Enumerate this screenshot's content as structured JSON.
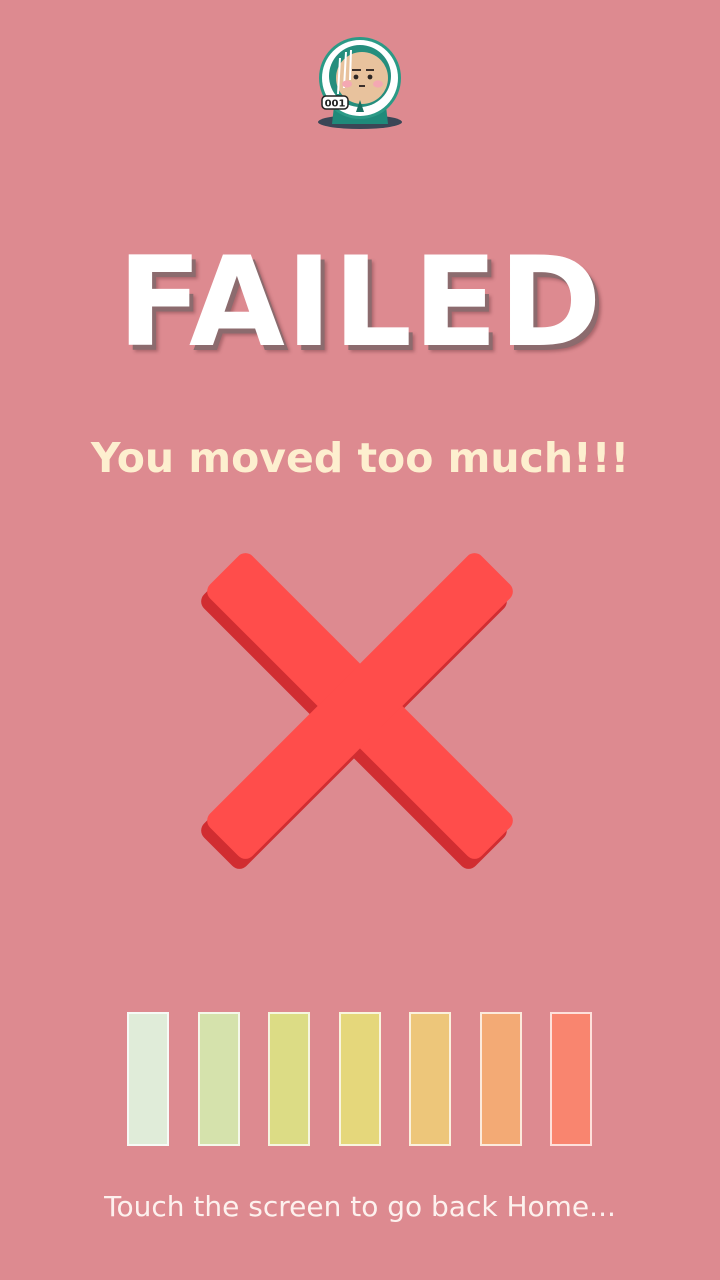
{
  "screen": {
    "title": "FAILED",
    "message": "You moved too much!!!",
    "footer_hint": "Touch the screen to go back Home..."
  },
  "avatar": {
    "icon": "player-avatar-icon",
    "badge_number": "001"
  },
  "result_icon": "x-mark-icon",
  "progress_bars": [
    {
      "color": "#e0ecd9"
    },
    {
      "color": "#d5e2ac"
    },
    {
      "color": "#dcdc85"
    },
    {
      "color": "#e5d77b"
    },
    {
      "color": "#edc67a"
    },
    {
      "color": "#f3aa75"
    },
    {
      "color": "#f9856f"
    }
  ],
  "colors": {
    "background": "#dd8a90",
    "title": "#ffffff",
    "message": "#fdefcf",
    "cross": "#ff4d4b",
    "cross_shadow": "#d12d31"
  }
}
